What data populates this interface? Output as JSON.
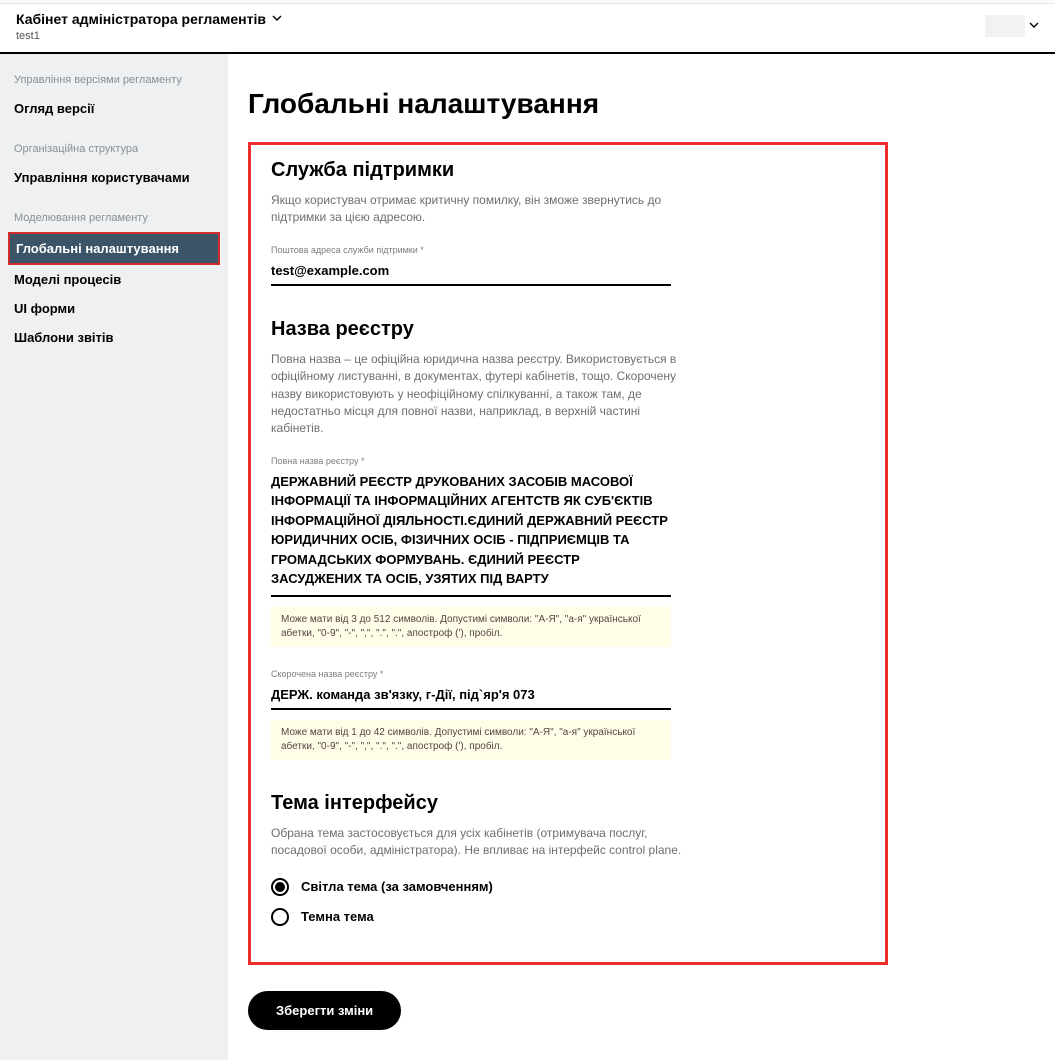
{
  "header": {
    "title": "Кабінет адміністратора регламентів",
    "subtitle": "test1"
  },
  "sidebar": {
    "section1_label": "Управління версіями регламенту",
    "item_overview": "Огляд версії",
    "section2_label": "Організаційна структура",
    "item_users": "Управління користувачами",
    "section3_label": "Моделювання регламенту",
    "item_global": "Глобальні налаштування",
    "item_models": "Моделі процесів",
    "item_forms": "UI форми",
    "item_reports": "Шаблони звітів"
  },
  "page": {
    "title": "Глобальні налаштування",
    "support": {
      "title": "Служба підтримки",
      "desc": "Якщо користувач отримає критичну помилку, він зможе звернутись до підтримки за цією адресою.",
      "email_label": "Поштова адреса служби підтримки *",
      "email_value": "test@example.com"
    },
    "registry": {
      "title": "Назва реєстру",
      "desc": "Повна назва – це офіційна юридична назва реєстру. Використовується в офіційному листуванні, в документах, футері кабінетів, тощо. Скорочену назву використовують у неофіційному спілкуванні, а також там, де недостатньо місця для повної назви, наприклад, в верхній частині кабінетів.",
      "fullname_label": "Повна назва реєстру *",
      "fullname_value": "ДЕРЖАВНИЙ РЕЄСТР ДРУКОВАНИХ ЗАСОБІВ МАСОВОЇ ІНФОРМАЦІЇ ТА ІНФОРМАЦІЙНИХ АГЕНТСТВ ЯК СУБ'ЄКТІВ ІНФОРМАЦІЙНОЇ ДІЯЛЬНОСТІ.ЄДИНИЙ ДЕРЖАВНИЙ РЕЄСТР ЮРИДИЧНИХ ОСІБ, ФІЗИЧНИХ ОСІБ - ПІДПРИЄМЦІВ ТА ГРОМАДСЬКИХ ФОРМУВАНЬ. ЄДИНИЙ РЕЄСТР ЗАСУДЖЕНИХ ТА ОСІБ, УЗЯТИХ ПІД ВАРТУ",
      "fullname_hint": "Може мати від 3 до 512 символів. Допустимі символи: \"А-Я\", \"а-я\" української абетки, \"0-9\", \"-\", \",\", \".\", \".\", апостроф ('), пробіл.",
      "shortname_label": "Скорочена назва реєстру *",
      "shortname_value": "ДЕРЖ. команда зв'язку, г-Дії, під`яр'я 073",
      "shortname_hint": "Може мати від 1 до 42 символів. Допустимі символи: \"А-Я\", \"а-я\" української абетки, \"0-9\", \"-\", \",\", \".\", \".\", апостроф ('), пробіл."
    },
    "theme": {
      "title": "Тема інтерфейсу",
      "desc": "Обрана тема застосовується для усіх кабінетів (отримувача послуг, посадової особи, адміністратора). Не впливає на інтерфейс control plane.",
      "light_label": "Світла тема (за замовченням)",
      "dark_label": "Темна тема",
      "selected": "light"
    },
    "save_label": "Зберегти зміни"
  }
}
